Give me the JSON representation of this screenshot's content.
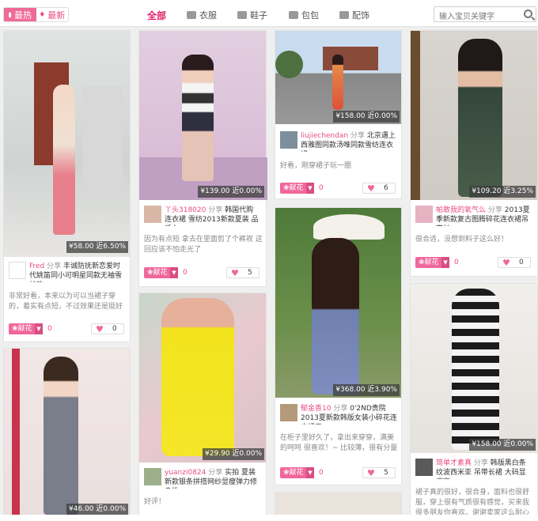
{
  "sort": {
    "hot": "最热",
    "new": "最新"
  },
  "nav": {
    "all": "全部",
    "clothes": "衣服",
    "shoes": "鞋子",
    "bags": "包包",
    "accessories": "配饰"
  },
  "search": {
    "placeholder": "输入宝贝关键字"
  },
  "flower_label": "献花",
  "cards": [
    {
      "price": "¥58.00",
      "near": "近6.50%",
      "user": "Fred",
      "share": "分享",
      "title": "丰诚防抚新恋爱时代姚笛同小可明星同款无袖雪纺欧",
      "comment": "非常好看，本来以为可以当裙子穿的，着实有点短，不过效果还是挺好的",
      "flowers": "0",
      "likes": "0"
    },
    {
      "price": "¥46.00",
      "near": "近0.00%"
    },
    {
      "price": "¥139.00",
      "near": "近0.00%",
      "user": "丫头318020",
      "share": "分享",
      "title": "韩国代购 连衣裙 雪纺2013新款夏装 品质女",
      "comment": "因为有点短 拿去在里面剪了个裤衩 这回应该不怕走光了",
      "flowers": "0",
      "likes": "5"
    },
    {
      "price": "¥29.90",
      "near": "近0.00%",
      "user": "yuanzi0824",
      "share": "分享",
      "title": "实拍 夏装新款银条拼搭网纱显瘦弹力修身性",
      "comment": "好评！"
    },
    {
      "price": "¥158.00",
      "near": "近0.00%",
      "user": "liujiechendan",
      "share": "分享",
      "title": "北京遇上西雅图同款汤唯同款雪纺连衣裙",
      "comment": "好看，刚穿裙子玩一圈",
      "flowers": "0",
      "likes": "6"
    },
    {
      "price": "¥368.00",
      "near": "近3.90%",
      "user": "郁金香10",
      "share": "分享",
      "title": "0'2ND贵院2013夏新款韩版女装小碎花连衣裙无",
      "comment": "在柜子里好久了，拿出来穿穿，满美的呵呵 很喜欢！~ 比较薄，很有分量",
      "flowers": "0",
      "likes": "5"
    },
    {
      "price": "¥109.20",
      "near": "近3.25%",
      "user": "帕敢我的氧气么",
      "share": "分享",
      "title": "2013夏季新款复古图腾碎花连衣裙吊带长",
      "comment": "很合适，没想到料子这么好！",
      "flowers": "0",
      "likes": "0"
    },
    {
      "price": "¥158.00",
      "near": "近0.00%",
      "user": "简单才素真",
      "share": "分享",
      "title": "韩版黑白条纹波西米亚 吊带长裙 大码显瘦高",
      "comment": "裙子真的很好，很合身，面料也很舒服，穿上很有气质很有感觉，买来我很多朋友你喜欢。谢谢卖家这么耐心的帮"
    }
  ],
  "colors": {
    "accent": "#e94c84",
    "flower": "#f0679b"
  }
}
